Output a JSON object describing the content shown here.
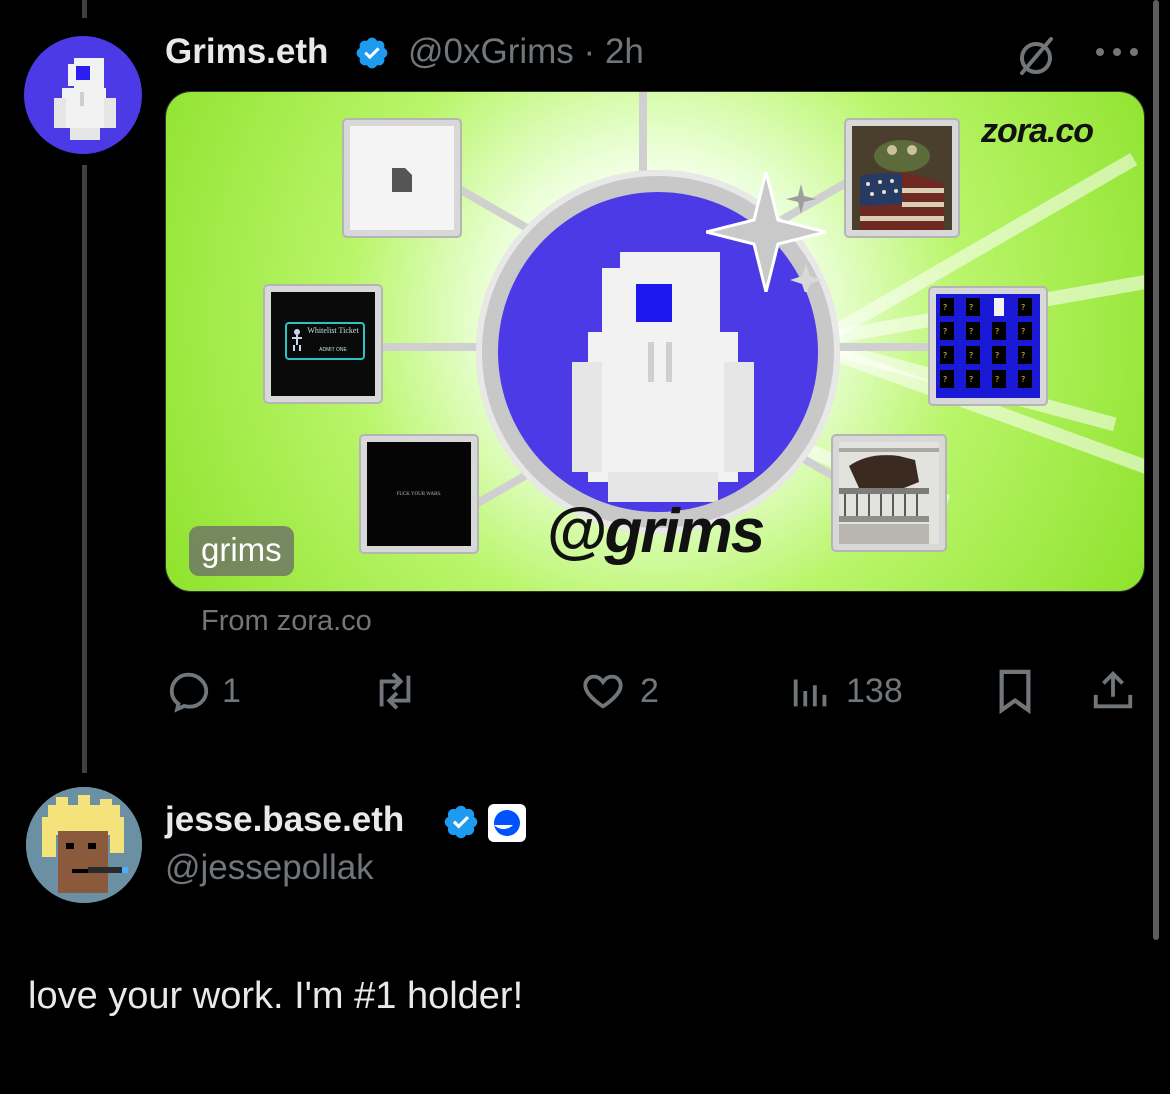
{
  "tweet": {
    "display_name": "Grims.eth",
    "handle": "@0xGrims",
    "separator": "·",
    "time": "2h",
    "card": {
      "brand": "zora.co",
      "handle_label": "@grims",
      "tag_label": "grims",
      "thumb_ticket_title": "Whitelist Ticket",
      "thumb_ticket_sub": "ADMIT ONE",
      "thumb_wars_text": "FUCK YOUR WARS."
    },
    "source": "From zora.co",
    "stats": {
      "replies": "1",
      "reposts": "",
      "likes": "2",
      "views": "138"
    }
  },
  "reply": {
    "display_name": "jesse.base.eth",
    "handle": "@jessepollak",
    "text": "love your work. I'm #1 holder!"
  },
  "colors": {
    "background": "#000000",
    "verified": "#1d9bf0",
    "muted": "#71767b",
    "avatar_blue": "#4b3ae6",
    "card_green": "#8ee22c"
  },
  "icons": [
    "verified-badge-icon",
    "grok-icon",
    "more-icon",
    "reply-icon",
    "repost-icon",
    "like-icon",
    "views-icon",
    "bookmark-icon",
    "share-icon",
    "base-badge-icon"
  ]
}
